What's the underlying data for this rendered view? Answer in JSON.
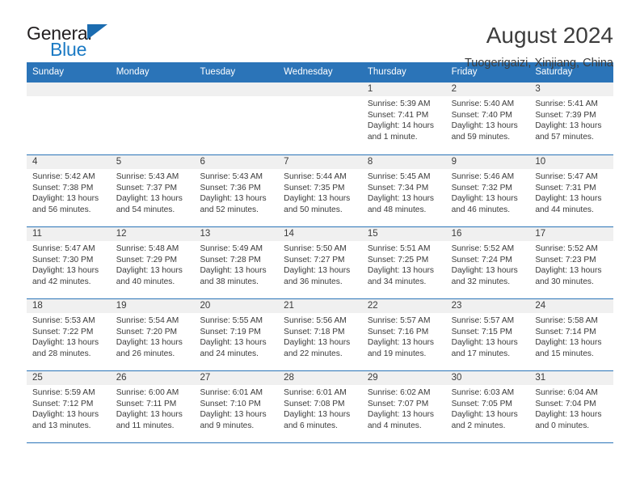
{
  "logo": {
    "text_top": "General",
    "text_bottom": "Blue",
    "accent_dark": "#1b6cb0",
    "accent_light": "#1b7ac4"
  },
  "header": {
    "title": "August 2024",
    "location": "Tuogerigaizi, Xinjiang, China"
  },
  "theme": {
    "header_blue": "#2b74b8",
    "date_band_gray": "#f0f0f0",
    "text": "#3a3a3a"
  },
  "weekdays": [
    "Sunday",
    "Monday",
    "Tuesday",
    "Wednesday",
    "Thursday",
    "Friday",
    "Saturday"
  ],
  "weeks": [
    [
      {
        "day": "",
        "sunrise": "",
        "sunset": "",
        "daylight1": "",
        "daylight2": "",
        "empty": true
      },
      {
        "day": "",
        "sunrise": "",
        "sunset": "",
        "daylight1": "",
        "daylight2": "",
        "empty": true
      },
      {
        "day": "",
        "sunrise": "",
        "sunset": "",
        "daylight1": "",
        "daylight2": "",
        "empty": true
      },
      {
        "day": "",
        "sunrise": "",
        "sunset": "",
        "daylight1": "",
        "daylight2": "",
        "empty": true
      },
      {
        "day": "1",
        "sunrise": "Sunrise: 5:39 AM",
        "sunset": "Sunset: 7:41 PM",
        "daylight1": "Daylight: 14 hours",
        "daylight2": "and 1 minute.",
        "empty": false
      },
      {
        "day": "2",
        "sunrise": "Sunrise: 5:40 AM",
        "sunset": "Sunset: 7:40 PM",
        "daylight1": "Daylight: 13 hours",
        "daylight2": "and 59 minutes.",
        "empty": false
      },
      {
        "day": "3",
        "sunrise": "Sunrise: 5:41 AM",
        "sunset": "Sunset: 7:39 PM",
        "daylight1": "Daylight: 13 hours",
        "daylight2": "and 57 minutes.",
        "empty": false
      }
    ],
    [
      {
        "day": "4",
        "sunrise": "Sunrise: 5:42 AM",
        "sunset": "Sunset: 7:38 PM",
        "daylight1": "Daylight: 13 hours",
        "daylight2": "and 56 minutes.",
        "empty": false
      },
      {
        "day": "5",
        "sunrise": "Sunrise: 5:43 AM",
        "sunset": "Sunset: 7:37 PM",
        "daylight1": "Daylight: 13 hours",
        "daylight2": "and 54 minutes.",
        "empty": false
      },
      {
        "day": "6",
        "sunrise": "Sunrise: 5:43 AM",
        "sunset": "Sunset: 7:36 PM",
        "daylight1": "Daylight: 13 hours",
        "daylight2": "and 52 minutes.",
        "empty": false
      },
      {
        "day": "7",
        "sunrise": "Sunrise: 5:44 AM",
        "sunset": "Sunset: 7:35 PM",
        "daylight1": "Daylight: 13 hours",
        "daylight2": "and 50 minutes.",
        "empty": false
      },
      {
        "day": "8",
        "sunrise": "Sunrise: 5:45 AM",
        "sunset": "Sunset: 7:34 PM",
        "daylight1": "Daylight: 13 hours",
        "daylight2": "and 48 minutes.",
        "empty": false
      },
      {
        "day": "9",
        "sunrise": "Sunrise: 5:46 AM",
        "sunset": "Sunset: 7:32 PM",
        "daylight1": "Daylight: 13 hours",
        "daylight2": "and 46 minutes.",
        "empty": false
      },
      {
        "day": "10",
        "sunrise": "Sunrise: 5:47 AM",
        "sunset": "Sunset: 7:31 PM",
        "daylight1": "Daylight: 13 hours",
        "daylight2": "and 44 minutes.",
        "empty": false
      }
    ],
    [
      {
        "day": "11",
        "sunrise": "Sunrise: 5:47 AM",
        "sunset": "Sunset: 7:30 PM",
        "daylight1": "Daylight: 13 hours",
        "daylight2": "and 42 minutes.",
        "empty": false
      },
      {
        "day": "12",
        "sunrise": "Sunrise: 5:48 AM",
        "sunset": "Sunset: 7:29 PM",
        "daylight1": "Daylight: 13 hours",
        "daylight2": "and 40 minutes.",
        "empty": false
      },
      {
        "day": "13",
        "sunrise": "Sunrise: 5:49 AM",
        "sunset": "Sunset: 7:28 PM",
        "daylight1": "Daylight: 13 hours",
        "daylight2": "and 38 minutes.",
        "empty": false
      },
      {
        "day": "14",
        "sunrise": "Sunrise: 5:50 AM",
        "sunset": "Sunset: 7:27 PM",
        "daylight1": "Daylight: 13 hours",
        "daylight2": "and 36 minutes.",
        "empty": false
      },
      {
        "day": "15",
        "sunrise": "Sunrise: 5:51 AM",
        "sunset": "Sunset: 7:25 PM",
        "daylight1": "Daylight: 13 hours",
        "daylight2": "and 34 minutes.",
        "empty": false
      },
      {
        "day": "16",
        "sunrise": "Sunrise: 5:52 AM",
        "sunset": "Sunset: 7:24 PM",
        "daylight1": "Daylight: 13 hours",
        "daylight2": "and 32 minutes.",
        "empty": false
      },
      {
        "day": "17",
        "sunrise": "Sunrise: 5:52 AM",
        "sunset": "Sunset: 7:23 PM",
        "daylight1": "Daylight: 13 hours",
        "daylight2": "and 30 minutes.",
        "empty": false
      }
    ],
    [
      {
        "day": "18",
        "sunrise": "Sunrise: 5:53 AM",
        "sunset": "Sunset: 7:22 PM",
        "daylight1": "Daylight: 13 hours",
        "daylight2": "and 28 minutes.",
        "empty": false
      },
      {
        "day": "19",
        "sunrise": "Sunrise: 5:54 AM",
        "sunset": "Sunset: 7:20 PM",
        "daylight1": "Daylight: 13 hours",
        "daylight2": "and 26 minutes.",
        "empty": false
      },
      {
        "day": "20",
        "sunrise": "Sunrise: 5:55 AM",
        "sunset": "Sunset: 7:19 PM",
        "daylight1": "Daylight: 13 hours",
        "daylight2": "and 24 minutes.",
        "empty": false
      },
      {
        "day": "21",
        "sunrise": "Sunrise: 5:56 AM",
        "sunset": "Sunset: 7:18 PM",
        "daylight1": "Daylight: 13 hours",
        "daylight2": "and 22 minutes.",
        "empty": false
      },
      {
        "day": "22",
        "sunrise": "Sunrise: 5:57 AM",
        "sunset": "Sunset: 7:16 PM",
        "daylight1": "Daylight: 13 hours",
        "daylight2": "and 19 minutes.",
        "empty": false
      },
      {
        "day": "23",
        "sunrise": "Sunrise: 5:57 AM",
        "sunset": "Sunset: 7:15 PM",
        "daylight1": "Daylight: 13 hours",
        "daylight2": "and 17 minutes.",
        "empty": false
      },
      {
        "day": "24",
        "sunrise": "Sunrise: 5:58 AM",
        "sunset": "Sunset: 7:14 PM",
        "daylight1": "Daylight: 13 hours",
        "daylight2": "and 15 minutes.",
        "empty": false
      }
    ],
    [
      {
        "day": "25",
        "sunrise": "Sunrise: 5:59 AM",
        "sunset": "Sunset: 7:12 PM",
        "daylight1": "Daylight: 13 hours",
        "daylight2": "and 13 minutes.",
        "empty": false
      },
      {
        "day": "26",
        "sunrise": "Sunrise: 6:00 AM",
        "sunset": "Sunset: 7:11 PM",
        "daylight1": "Daylight: 13 hours",
        "daylight2": "and 11 minutes.",
        "empty": false
      },
      {
        "day": "27",
        "sunrise": "Sunrise: 6:01 AM",
        "sunset": "Sunset: 7:10 PM",
        "daylight1": "Daylight: 13 hours",
        "daylight2": "and 9 minutes.",
        "empty": false
      },
      {
        "day": "28",
        "sunrise": "Sunrise: 6:01 AM",
        "sunset": "Sunset: 7:08 PM",
        "daylight1": "Daylight: 13 hours",
        "daylight2": "and 6 minutes.",
        "empty": false
      },
      {
        "day": "29",
        "sunrise": "Sunrise: 6:02 AM",
        "sunset": "Sunset: 7:07 PM",
        "daylight1": "Daylight: 13 hours",
        "daylight2": "and 4 minutes.",
        "empty": false
      },
      {
        "day": "30",
        "sunrise": "Sunrise: 6:03 AM",
        "sunset": "Sunset: 7:05 PM",
        "daylight1": "Daylight: 13 hours",
        "daylight2": "and 2 minutes.",
        "empty": false
      },
      {
        "day": "31",
        "sunrise": "Sunrise: 6:04 AM",
        "sunset": "Sunset: 7:04 PM",
        "daylight1": "Daylight: 13 hours",
        "daylight2": "and 0 minutes.",
        "empty": false
      }
    ]
  ]
}
